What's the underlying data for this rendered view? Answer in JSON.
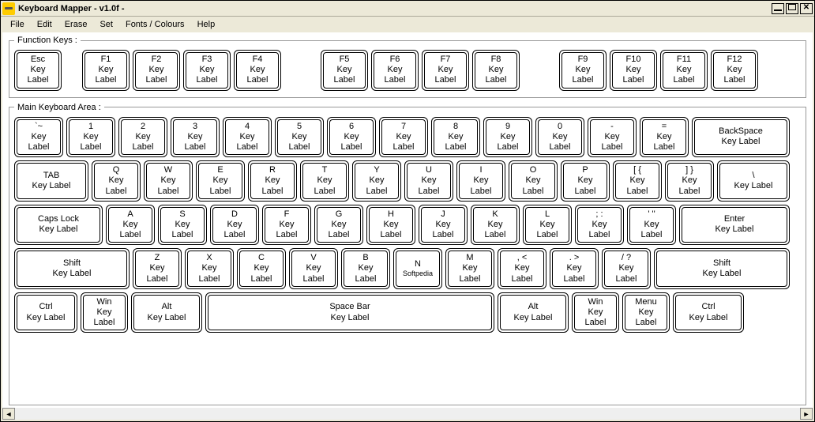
{
  "window": {
    "title": "Keyboard Mapper - v1.0f  -"
  },
  "menu": {
    "file": "File",
    "edit": "Edit",
    "erase": "Erase",
    "set": "Set",
    "fonts": "Fonts / Colours",
    "help": "Help"
  },
  "group": {
    "function": "Function Keys :",
    "main": "Main Keyboard Area :"
  },
  "label": {
    "key": "Key",
    "label": "Label",
    "key_label": "Key Label"
  },
  "fkeys": [
    "Esc",
    "F1",
    "F2",
    "F3",
    "F4",
    "F5",
    "F6",
    "F7",
    "F8",
    "F9",
    "F10",
    "F11",
    "F12"
  ],
  "row1": {
    "keys": [
      "`~",
      "1",
      "2",
      "3",
      "4",
      "5",
      "6",
      "7",
      "8",
      "9",
      "0",
      "-",
      "="
    ],
    "backspace": "BackSpace"
  },
  "row2": {
    "tab": "TAB",
    "keys": [
      "Q",
      "W",
      "E",
      "R",
      "T",
      "Y",
      "U",
      "I",
      "O",
      "P",
      "[ {",
      "] }"
    ],
    "bslash": "\\"
  },
  "row3": {
    "caps": "Caps Lock",
    "keys": [
      "A",
      "S",
      "D",
      "F",
      "G",
      "H",
      "J",
      "K",
      "L",
      "; :",
      "' ''"
    ],
    "enter": "Enter"
  },
  "row4": {
    "lshift": "Shift",
    "keys": [
      "Z",
      "X",
      "C",
      "V",
      "B",
      "N",
      "M",
      ", <",
      ". >",
      "/ ?"
    ],
    "rshift": "Shift",
    "soft": "Softpedia"
  },
  "row5": {
    "lctrl": "Ctrl",
    "lwin": "Win",
    "lalt": "Alt",
    "space": "Space Bar",
    "ralt": "Alt",
    "rwin": "Win",
    "menu": "Menu",
    "rctrl": "Ctrl"
  }
}
